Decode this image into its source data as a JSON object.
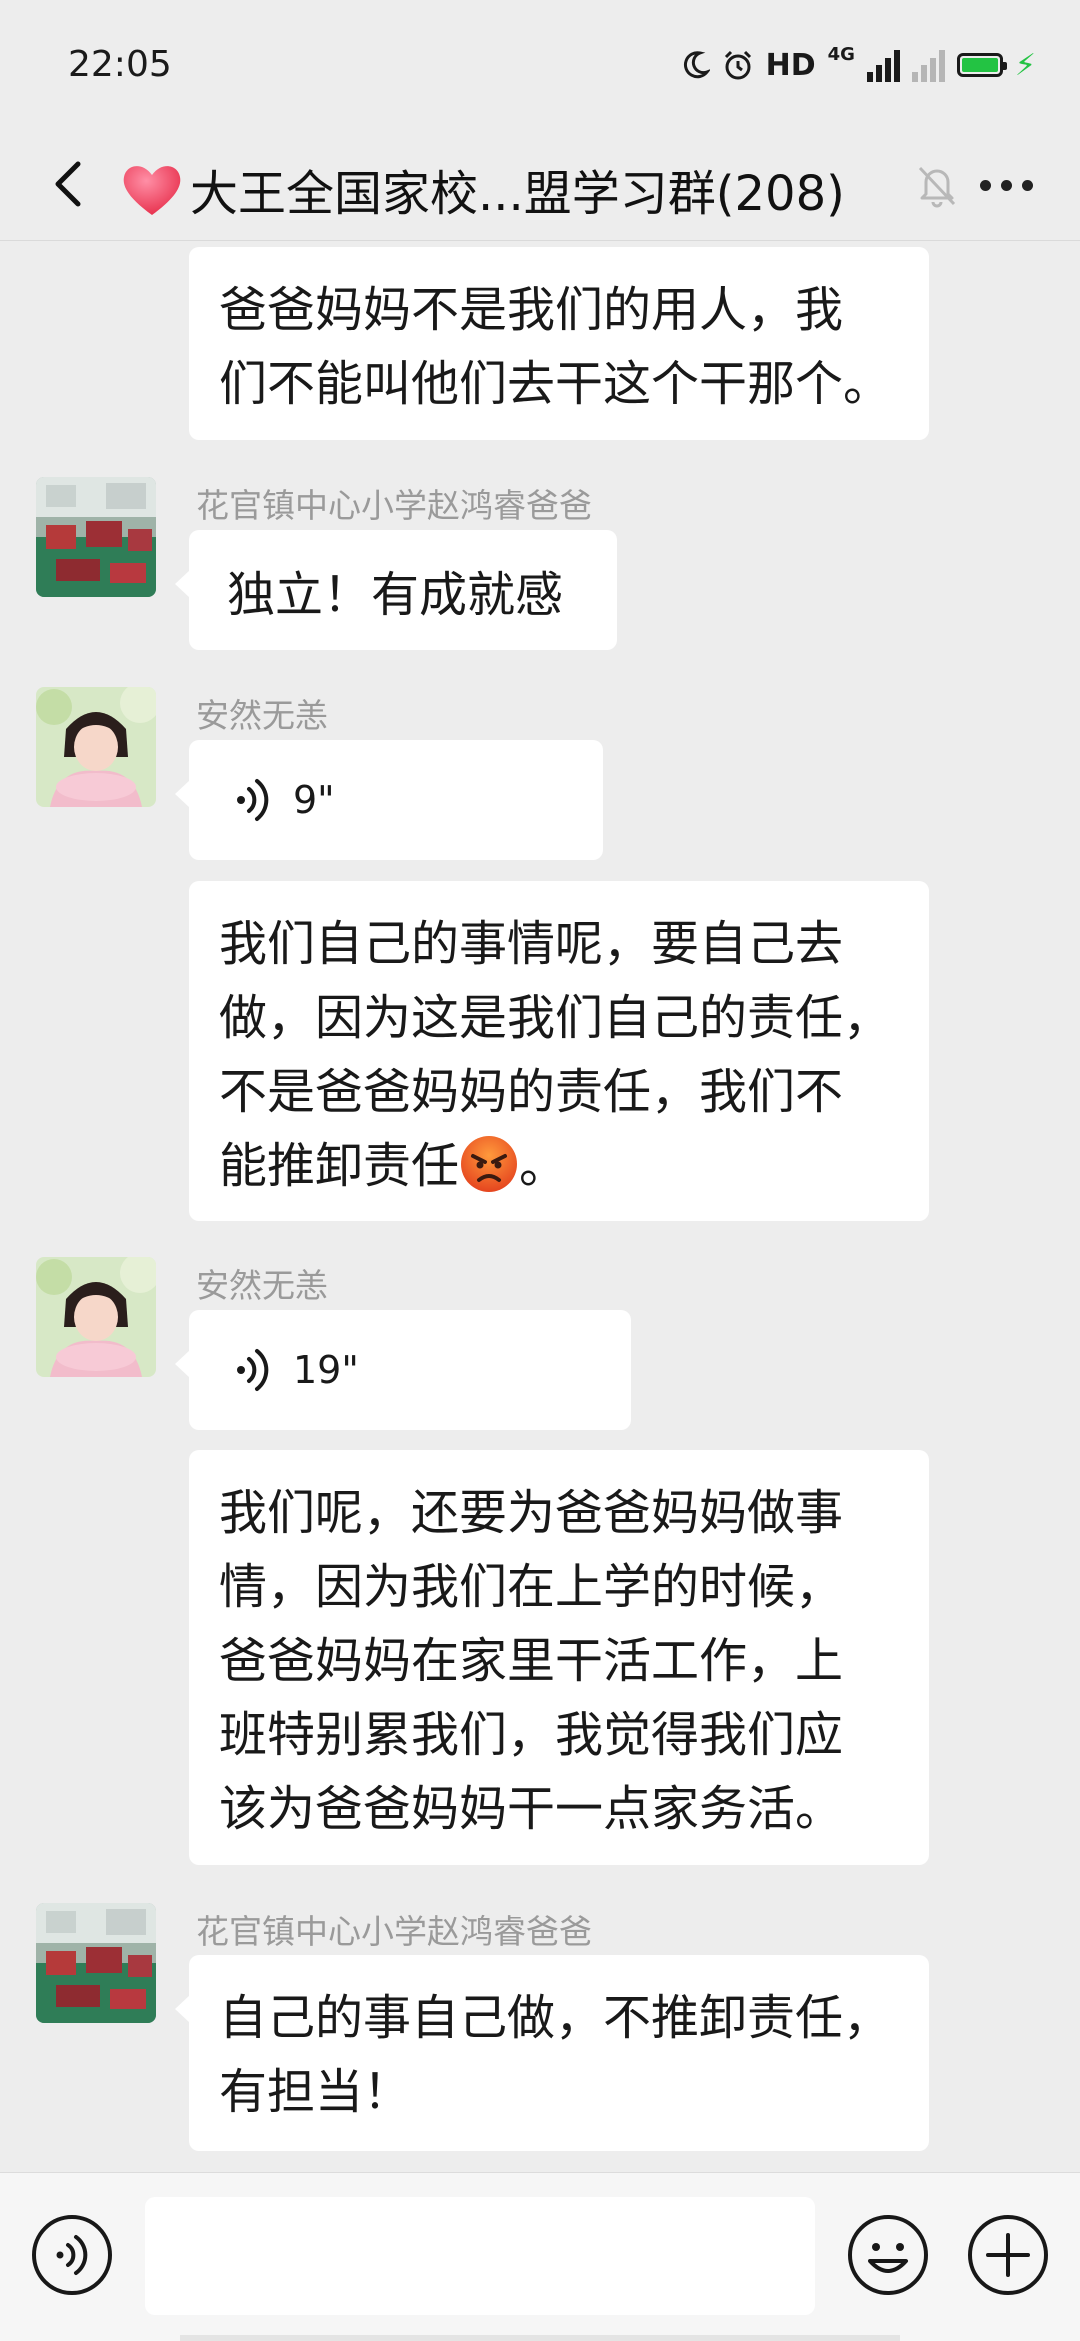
{
  "status_bar": {
    "time": "22:05",
    "hd": "HD",
    "network": "4G",
    "icons": [
      "moon-icon",
      "alarm-icon",
      "signal-icon",
      "battery-icon",
      "charging-icon"
    ]
  },
  "header": {
    "title": "大王全国家校...盟学习群(208)",
    "icons": [
      "back-icon",
      "heart-icon",
      "mute-icon",
      "more-icon"
    ]
  },
  "messages": [
    {
      "type": "text",
      "text_lines": [
        "爸爸妈妈不是我们的用人，我",
        "们不能叫他们去干这个干那个。"
      ]
    },
    {
      "type": "text",
      "sender": "花官镇中心小学赵鸿睿爸爸",
      "text": "独立！有成就感"
    },
    {
      "type": "voice",
      "sender": "安然无恙",
      "duration": "9\""
    },
    {
      "type": "text",
      "text_lines": [
        "我们自己的事情呢，要自己去",
        "做，因为这是我们自己的责任，",
        "不是爸爸妈妈的责任，我们不",
        "能推卸责任"
      ],
      "trailing": "。",
      "emoji": "angry-face-emoji"
    },
    {
      "type": "voice",
      "sender": "安然无恙",
      "duration": "19\""
    },
    {
      "type": "text",
      "text_lines": [
        "我们呢，还要为爸爸妈妈做事",
        "情，因为我们在上学的时候，",
        "爸爸妈妈在家里干活工作，上",
        "班特别累我们，我觉得我们应",
        "该为爸爸妈妈干一点家务活。"
      ]
    },
    {
      "type": "text",
      "sender": "花官镇中心小学赵鸿睿爸爸",
      "text_lines": [
        "自己的事自己做，不推卸责任，",
        "有担当！"
      ]
    }
  ],
  "input_bar": {
    "text_value": "",
    "icons": [
      "voice-input-icon",
      "emoji-icon",
      "plus-icon"
    ]
  },
  "colors": {
    "background": "#ededed",
    "bubble": "#ffffff",
    "sender_name": "#9a9a9a",
    "battery": "#23c343"
  }
}
